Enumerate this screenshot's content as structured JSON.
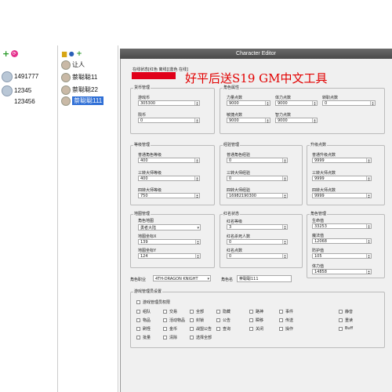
{
  "contacts": {
    "items": [
      {
        "id": "1491777"
      },
      {
        "id": "12345"
      },
      {
        "id": "123456"
      }
    ]
  },
  "roles": {
    "items": [
      {
        "name": "让人"
      },
      {
        "name": "萘聪聪11"
      },
      {
        "name": "萘聪聪22"
      },
      {
        "name": "萘聪聪111"
      }
    ]
  },
  "editor": {
    "title": "Character Editor",
    "status": "在线状态[红色 离线][蓝色 在线]",
    "promo": "好平后送S19 GM中文工具",
    "currency": {
      "title": "货币管理",
      "game_coin_label": "游戏币",
      "game_coin_value": "305300",
      "zhuanbi_label": "陨币",
      "zhuanbi_value": "0"
    },
    "attributes": {
      "title": "角色属性",
      "power_label": "力量点数",
      "power_value": "9000",
      "stamina_label": "体力点数",
      "stamina_value": "9000",
      "transfer_label": "转职点数",
      "transfer_value": "0",
      "agility_label": "敏捷点数",
      "agility_value": "9000",
      "mana_label": "智力点数",
      "mana_value": "9000"
    },
    "level": {
      "title": "等级管理",
      "normal_label": "普通角色等级",
      "normal_value": "400",
      "master3_label": "三转大师等级",
      "master3_value": "400",
      "master4_label": "四转大师等级",
      "master4_value": "750"
    },
    "exp": {
      "title": "经验管理",
      "normal_label": "普通角色经验",
      "normal_value": "0",
      "master3_label": "三转大师经验",
      "master3_value": "0",
      "master4_label": "四转大师经验",
      "master4_value": "16982190300"
    },
    "upgrade": {
      "title": "升级点数",
      "normal_label": "普通升级点数",
      "normal_value": "9999",
      "master3_label": "三转大师点数",
      "master3_value": "9999",
      "master4_label": "四转大师点数",
      "master4_value": "9999"
    },
    "map": {
      "title": "地图管理",
      "map_label": "角色地图",
      "map_value": "勇者大陆",
      "x_label": "地图坐标X",
      "x_value": "139",
      "y_label": "地图坐标Y",
      "y_value": "124"
    },
    "redname": {
      "title": "红名状态",
      "level_label": "红名等级",
      "level_value": "3",
      "kills_label": "红名杀死人数",
      "kills_value": "0",
      "points_label": "红名点数",
      "points_value": "0"
    },
    "role": {
      "title": "角色管理",
      "hp_label": "生命值",
      "hp_value": "33253",
      "mp_label": "魔法值",
      "mp_value": "12068",
      "def_label": "防护值",
      "def_value": "105",
      "stamina_label": "体力值",
      "stamina_value": "14858"
    },
    "class_label": "角色职业",
    "class_value": "4TH-DRAGON KNIGHT",
    "name_label": "角色名",
    "name_value": "萘聪聪111",
    "gm": {
      "title": "游戏管理员设置",
      "permission_label": "游戏管理员权限",
      "items": [
        "组队",
        "交易",
        "全部",
        "隐藏",
        "路神",
        "事件",
        "静音",
        "物品",
        "活动物品",
        "封锁",
        "公告",
        "瞬移",
        "传送",
        "重读",
        "刷怪",
        "金币",
        "战盟公告",
        "查询",
        "关闭",
        "操作",
        "Buff",
        "批量",
        "清除",
        "选择全部"
      ]
    }
  }
}
